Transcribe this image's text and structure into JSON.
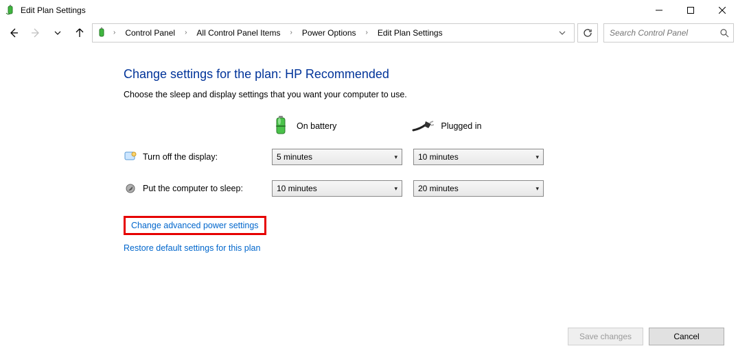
{
  "window": {
    "title": "Edit Plan Settings"
  },
  "breadcrumbs": {
    "items": [
      "Control Panel",
      "All Control Panel Items",
      "Power Options",
      "Edit Plan Settings"
    ]
  },
  "search": {
    "placeholder": "Search Control Panel"
  },
  "page": {
    "heading": "Change settings for the plan: HP Recommended",
    "subtext": "Choose the sleep and display settings that you want your computer to use.",
    "columns": {
      "battery": "On battery",
      "plugged": "Plugged in"
    },
    "rows": {
      "display": {
        "label": "Turn off the display:",
        "battery": "5 minutes",
        "plugged": "10 minutes"
      },
      "sleep": {
        "label": "Put the computer to sleep:",
        "battery": "10 minutes",
        "plugged": "20 minutes"
      }
    },
    "links": {
      "advanced": "Change advanced power settings",
      "restore": "Restore default settings for this plan"
    }
  },
  "footer": {
    "save": "Save changes",
    "cancel": "Cancel"
  }
}
